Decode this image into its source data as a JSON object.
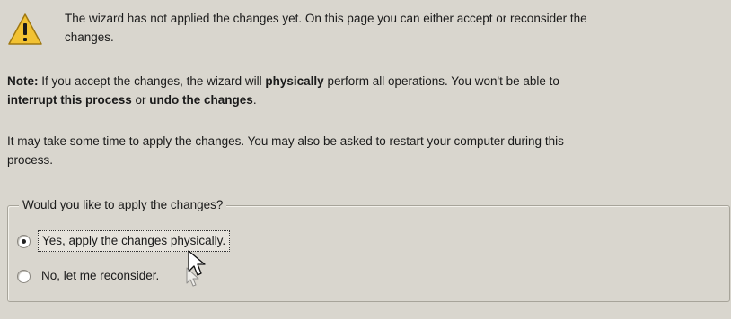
{
  "warning": {
    "icon": "warning-icon",
    "line1": "The wizard has not applied the changes yet. On this page you can either accept or reconsider the",
    "line2": "changes."
  },
  "note": {
    "label": "Note:",
    "text1": " If you accept the changes, the wizard will ",
    "bold1": "physically",
    "text2": " perform all operations. You won't be able to",
    "bold2": "interrupt this process",
    "text3": " or ",
    "bold3": "undo the changes",
    "text4": "."
  },
  "time": {
    "line1": "It may take some time to apply the changes. You may also be asked to restart your computer during this",
    "line2": "process."
  },
  "group": {
    "legend": "Would you like to apply the changes?",
    "options": [
      {
        "label": "Yes, apply the changes physically.",
        "selected": true
      },
      {
        "label": "No, let me reconsider.",
        "selected": false
      }
    ]
  }
}
